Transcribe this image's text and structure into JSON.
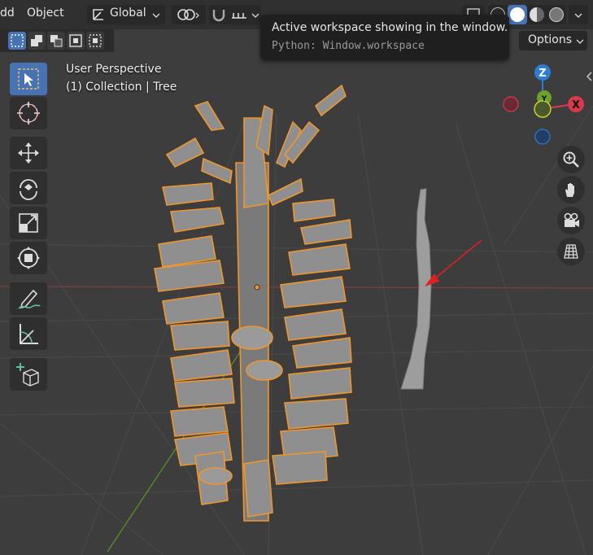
{
  "header": {
    "menu_edit": "dd",
    "menu_object": "Object",
    "transform_orientation": "Global"
  },
  "tooltip": {
    "title": "Active workspace showing in the window.",
    "python": "Python: Window.workspace"
  },
  "options_label": "Options",
  "viewport": {
    "view_name": "User Perspective",
    "collection_info": "(1) Collection | Tree"
  },
  "gizmo": {
    "z_label": "Z",
    "x_label": "X",
    "y_label": "Y",
    "colors": {
      "x": "#d8394b",
      "y": "#6ba22c",
      "z": "#2d7dd2",
      "selection": "#f0962b",
      "active_tool": "#4772b3"
    }
  },
  "toolbar_icons": [
    "select-box-icon",
    "cursor-icon",
    "move-icon",
    "rotate-icon",
    "scale-icon",
    "transform-icon",
    "annotate-icon",
    "measure-icon",
    "add-cube-icon"
  ],
  "nav_icons": [
    "zoom-icon",
    "hand-icon",
    "camera-icon",
    "grid-icon"
  ]
}
